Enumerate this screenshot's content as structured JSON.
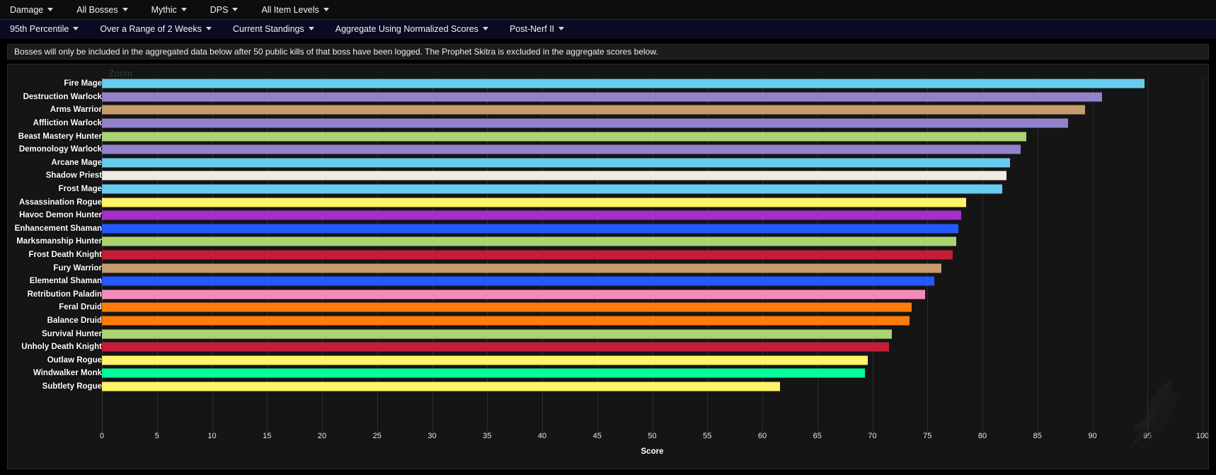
{
  "menubar": {
    "items": [
      {
        "label": "Damage",
        "icon": "chevron-down-icon"
      },
      {
        "label": "All Bosses",
        "icon": "chevron-down-icon"
      },
      {
        "label": "Mythic",
        "icon": "chevron-down-icon"
      },
      {
        "label": "DPS",
        "icon": "chevron-down-icon"
      },
      {
        "label": "All Item Levels",
        "icon": "chevron-down-icon"
      }
    ]
  },
  "filterbar": {
    "items": [
      {
        "label": "95th Percentile",
        "icon": "chevron-down-icon"
      },
      {
        "label": "Over a Range of 2 Weeks",
        "icon": "chevron-down-icon"
      },
      {
        "label": "Current Standings",
        "icon": "chevron-down-icon"
      },
      {
        "label": "Aggregate Using Normalized Scores",
        "icon": "chevron-down-icon"
      },
      {
        "label": "Post-Nerf II",
        "icon": "chevron-down-icon"
      }
    ]
  },
  "notice": {
    "text": "Bosses will only be included in the aggregated data below after 50 public kills of that boss have been logged. The Prophet Skitra is excluded in the aggregate scores below."
  },
  "chart_panel": {
    "zoom_label": "Zoom",
    "watermark": "logo-watermark"
  },
  "chart_data": {
    "type": "bar",
    "orientation": "horizontal",
    "title": "",
    "xlabel": "Score",
    "ylabel": "",
    "xlim": [
      0,
      100
    ],
    "xticks": [
      0,
      5,
      10,
      15,
      20,
      25,
      30,
      35,
      40,
      45,
      50,
      55,
      60,
      65,
      70,
      75,
      80,
      85,
      90,
      95,
      100
    ],
    "grid": true,
    "legend": "none",
    "categories": [
      "Fire Mage",
      "Destruction Warlock",
      "Arms Warrior",
      "Affliction Warlock",
      "Beast Mastery Hunter",
      "Demonology Warlock",
      "Arcane Mage",
      "Shadow Priest",
      "Frost Mage",
      "Assassination Rogue",
      "Havoc Demon Hunter",
      "Enhancement Shaman",
      "Marksmanship Hunter",
      "Frost Death Knight",
      "Fury Warrior",
      "Elemental Shaman",
      "Retribution Paladin",
      "Feral Druid",
      "Balance Druid",
      "Survival Hunter",
      "Unholy Death Knight",
      "Outlaw Rogue",
      "Windwalker Monk",
      "Subtlety Rogue"
    ],
    "values": [
      94.7,
      90.9,
      89.3,
      87.8,
      84.0,
      83.5,
      82.5,
      82.2,
      81.8,
      78.5,
      78.1,
      77.8,
      77.6,
      77.3,
      76.3,
      75.6,
      74.8,
      73.6,
      73.4,
      71.8,
      71.5,
      69.6,
      69.3,
      61.6
    ],
    "colors": [
      "#68ccef",
      "#9382c9",
      "#c69b6d",
      "#9382c9",
      "#aad372",
      "#9382c9",
      "#68ccef",
      "#f0ebe0",
      "#68ccef",
      "#fff468",
      "#a330c9",
      "#2359ff",
      "#aad372",
      "#c41e3a",
      "#c69b6d",
      "#2359ff",
      "#f48cba",
      "#ff7c0a",
      "#ff7c0a",
      "#aad372",
      "#c41e3a",
      "#fff468",
      "#00ff98",
      "#fff468"
    ]
  }
}
